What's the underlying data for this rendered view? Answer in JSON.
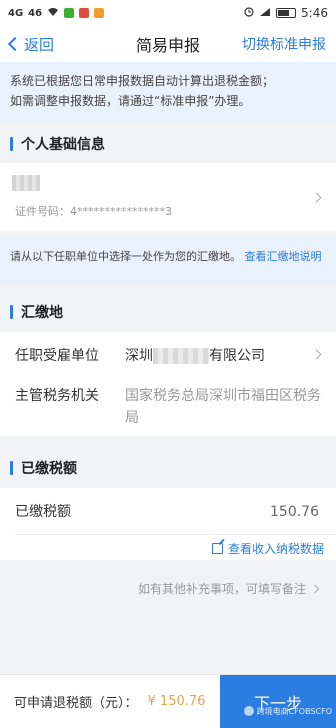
{
  "status_bar": {
    "carrier": "4G",
    "signal": "46",
    "time": "5:46",
    "battery_color": "#333333"
  },
  "nav": {
    "back_label": "返回",
    "title": "简易申报",
    "switch_label": "切换标准申报"
  },
  "notice": {
    "line1": "系统已根据您日常申报数据自动计算出退税金额；",
    "line2": "如需调整申报数据，请通过“标准申报”办理。"
  },
  "basic_info": {
    "title": "个人基础信息",
    "id_label": "证件号码：",
    "id_value": "4****************3"
  },
  "hint": {
    "text": "请从以下任职单位中选择一处作为您的汇缴地。",
    "link": "查看汇缴地说明"
  },
  "huijiao": {
    "title": "汇缴地",
    "employer_label": "任职受雇单位",
    "employer_prefix": "深圳",
    "employer_suffix": "有限公司",
    "tax_authority_label": "主管税务机关",
    "tax_authority_value": "国家税务总局深圳市福田区税务局"
  },
  "paid": {
    "title": "已缴税额",
    "label": "已缴税额",
    "value": "150.76",
    "check_link": "查看收入纳税数据"
  },
  "supplement": {
    "text": "如有其他补充事项，可填写备注"
  },
  "footer": {
    "label": "可申请退税额（元）：",
    "amount": "¥ 150.76",
    "next_label": "下一步",
    "watermark": "跨境电商CFOBSCFO"
  },
  "colors": {
    "accent": "#2b7de1",
    "amount": "#e8a34a",
    "notice_bg": "#e9f1fb"
  }
}
